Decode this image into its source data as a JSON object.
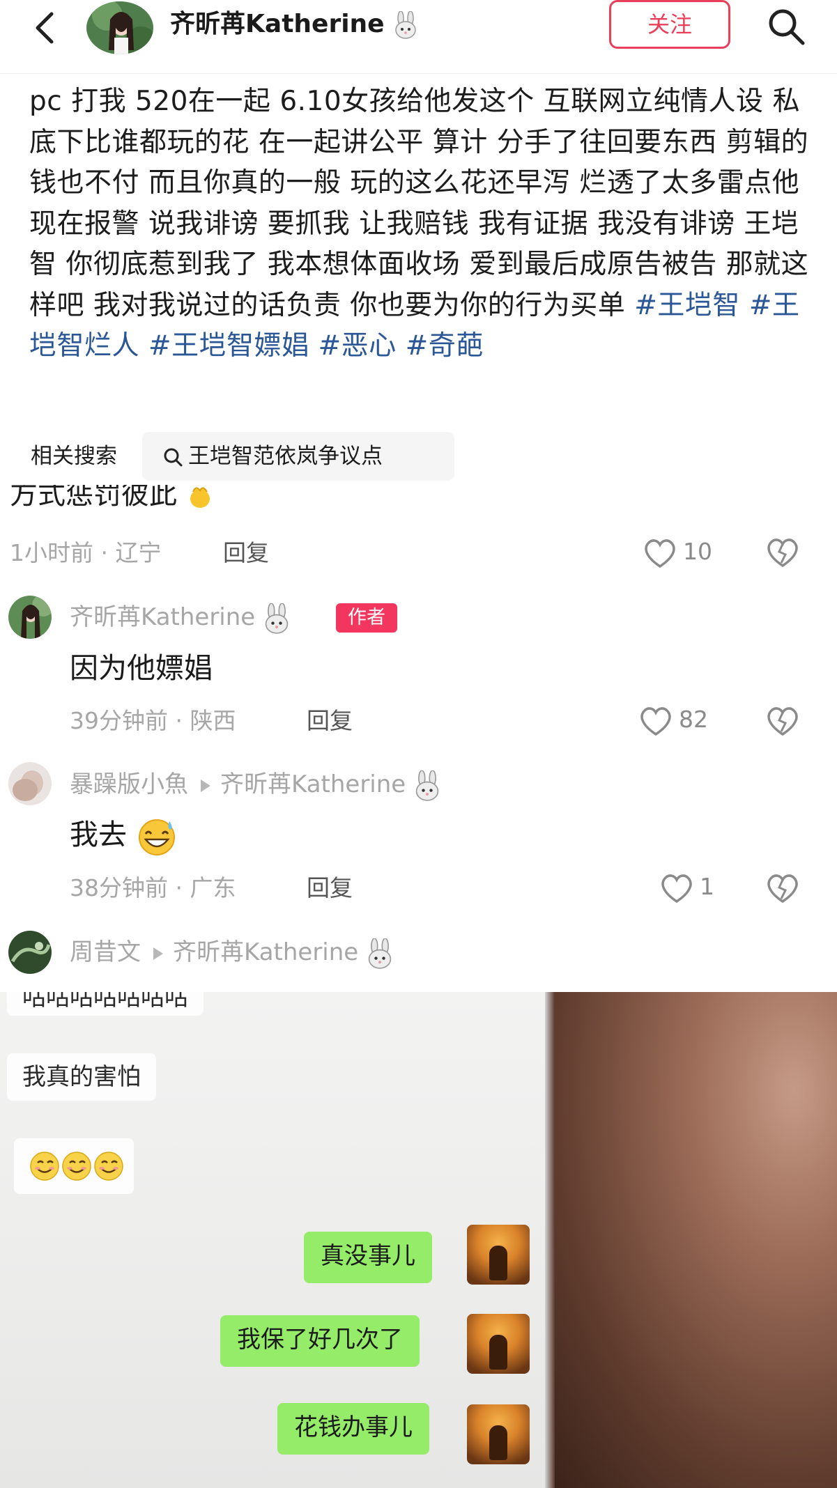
{
  "header": {
    "username": "齐昕苒Katherine",
    "follow_label": "关注"
  },
  "post": {
    "body_text": "pc 打我 520在一起 6.10女孩给他发这个 互联网立纯情人设 私底下比谁都玩的花 在一起讲公平 算计 分手了往回要东西 剪辑的钱也不付 而且你真的一般 玩的这么花还早泻 烂透了太多雷点他现在报警 说我诽谤 要抓我 让我赔钱 我有证据 我没有诽谤 王垲智 你彻底惹到我了 我本想体面收场 爱到最后成原告被告 那就这样吧 我对我说过的话负责 你也要为你的行为买单 ",
    "hashtags": [
      "#王垲智",
      "#王垲智烂人",
      "#王垲智嫖娼",
      "#恶心",
      "#奇葩"
    ]
  },
  "related": {
    "label": "相关搜索",
    "query": "王垲智范依岚争议点"
  },
  "comments": [
    {
      "text": "方式惩罚彼此",
      "time_location": "1小时前 · 辽宁",
      "reply_label": "回复",
      "likes": "10"
    },
    {
      "author": "齐昕苒Katherine",
      "badge": "作者",
      "text": "因为他嫖娼",
      "time_location": "39分钟前 · 陕西",
      "reply_label": "回复",
      "likes": "82"
    },
    {
      "author": "暴躁版小魚",
      "reply_to": "齐昕苒Katherine",
      "text": "我去",
      "time_location": "38分钟前 · 广东",
      "reply_label": "回复",
      "likes": "1"
    },
    {
      "author": "周昔文",
      "reply_to": "齐昕苒Katherine"
    }
  ],
  "chat": {
    "incoming": [
      "咕咕咕咕咕咕咕",
      "我真的害怕"
    ],
    "outgoing": [
      "真没事儿",
      "我保了好几次了",
      "花钱办事儿"
    ]
  },
  "colors": {
    "accent": "#ea3f5b",
    "hashtag": "#2b5797",
    "author_badge": "#f2365d",
    "chat_bubble_out": "#95ec69"
  },
  "icons": [
    "back-arrow-icon",
    "search-icon",
    "rabbit-emoji-icon",
    "magnifier-icon",
    "heart-icon",
    "broken-heart-icon",
    "grin-sweat-emoji-icon",
    "smile-emoji-icon",
    "clap-emoji-icon"
  ]
}
